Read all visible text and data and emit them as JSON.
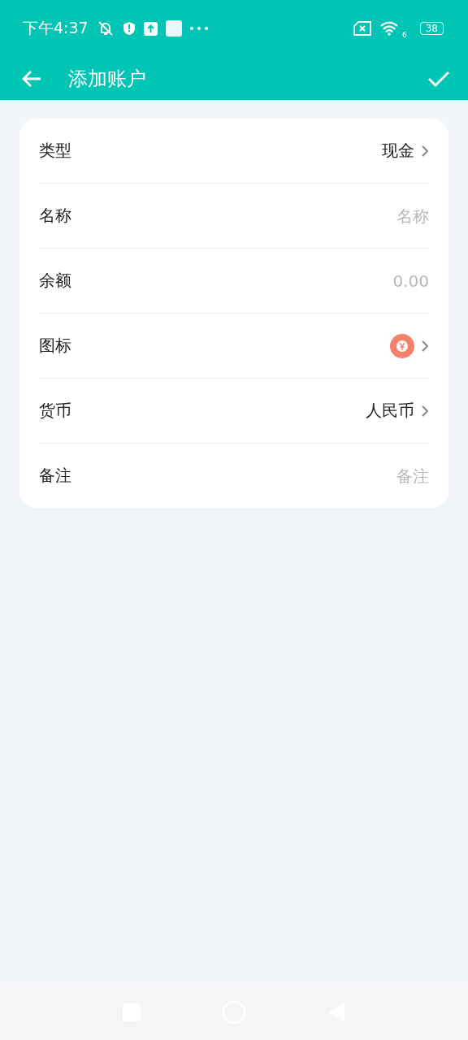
{
  "status_bar": {
    "time": "下午4:37",
    "wifi_badge": "6",
    "battery": "38"
  },
  "app_bar": {
    "title": "添加账户"
  },
  "rows": [
    {
      "kind": "select",
      "label": "类型",
      "value": "现金"
    },
    {
      "kind": "input",
      "label": "名称",
      "placeholder": "名称"
    },
    {
      "kind": "input",
      "label": "余额",
      "placeholder": "0.00"
    },
    {
      "kind": "icon",
      "label": "图标",
      "color": "#f5806b"
    },
    {
      "kind": "select",
      "label": "货币",
      "value": "人民币"
    },
    {
      "kind": "input",
      "label": "备注",
      "placeholder": "备注"
    }
  ]
}
